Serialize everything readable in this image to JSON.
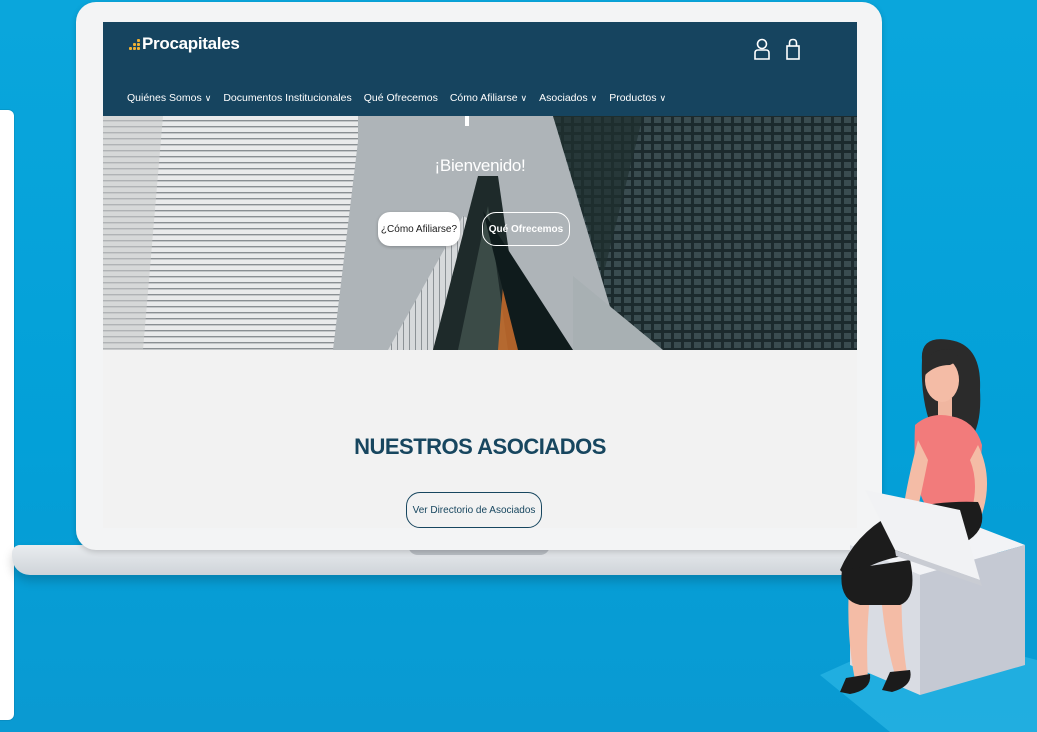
{
  "site": {
    "brand": "Procapitales",
    "nav": [
      {
        "label": "Quiénes Somos",
        "has_dropdown": true
      },
      {
        "label": "Documentos Institucionales",
        "has_dropdown": false
      },
      {
        "label": "Qué Ofrecemos",
        "has_dropdown": false
      },
      {
        "label": "Cómo Afiliarse",
        "has_dropdown": true
      },
      {
        "label": "Asociados",
        "has_dropdown": true
      },
      {
        "label": "Productos",
        "has_dropdown": true
      }
    ],
    "header_icons": [
      "user-icon",
      "shopping-bag-icon"
    ],
    "hero": {
      "title": "¡Bienvenido!",
      "primary_button": "¿Cómo Afiliarse?",
      "secondary_button": "Qué Ofrecemos"
    },
    "section": {
      "title": "NUESTROS ASOCIADOS",
      "button": "Ver Directorio de Asociados"
    }
  },
  "colors": {
    "background": "#03a0d8",
    "header": "#16445f",
    "accent": "#f2b233",
    "heading": "#17465f"
  }
}
